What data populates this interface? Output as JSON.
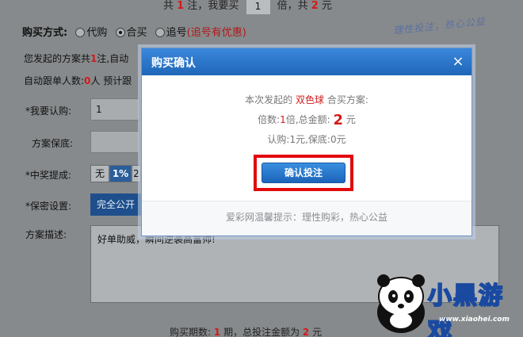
{
  "topline": {
    "prefix": "共",
    "notes": "1",
    "mid1": "注，我要买",
    "times": "1",
    "mid2": "倍，共",
    "amount": "2",
    "unit": "元"
  },
  "buy_mode": {
    "label": "购买方式:",
    "options": [
      "代购",
      "合买",
      "追号"
    ],
    "selected": "合买",
    "promo": "(追号有优惠)"
  },
  "slogan": "理性投注，热心公益",
  "info1": {
    "prefix": "您发起的方案共",
    "count": "1",
    "suffix": "注,自动"
  },
  "info2": {
    "prefix": "自动跟单人数:",
    "count": "0",
    "suffix": "人 预计跟"
  },
  "form": {
    "subscribe_label": "*我要认购:",
    "subscribe_value": "1",
    "guarantee_label": "方案保底:",
    "commission_label": "*中奖提成:",
    "commission_options": [
      "无",
      "1%",
      "2"
    ],
    "commission_selected": "1%",
    "secret_label": "*保密设置:",
    "secret_option": "完全公开",
    "desc_label": "方案描述:",
    "desc_value": "好单助威，瞬间逆袭高富帅!"
  },
  "bottom": {
    "prefix": "购买期数:",
    "periods": "1",
    "mid": "期，总投注金额为",
    "amount": "2",
    "unit": "元"
  },
  "modal": {
    "title": "购买确认",
    "close": "×",
    "line1_prefix": "本次发起的",
    "lottery": "双色球",
    "line1_suffix": "合买方案:",
    "line2_prefix": "倍数:",
    "multiple": "1",
    "line2_mid": "倍,总金额:",
    "total": "2",
    "line2_unit": "元",
    "line3": "认购:1元,保底:0元",
    "confirm_button": "确认投注",
    "footer": "爱彩网温馨提示：理性购彩，热心公益"
  },
  "watermark": {
    "text": "小黑游戏",
    "url": "www.xiaohei.com"
  },
  "colors": {
    "accent": "#2d78cd",
    "highlight": "#d21a1a",
    "frame": "#e3090c"
  }
}
